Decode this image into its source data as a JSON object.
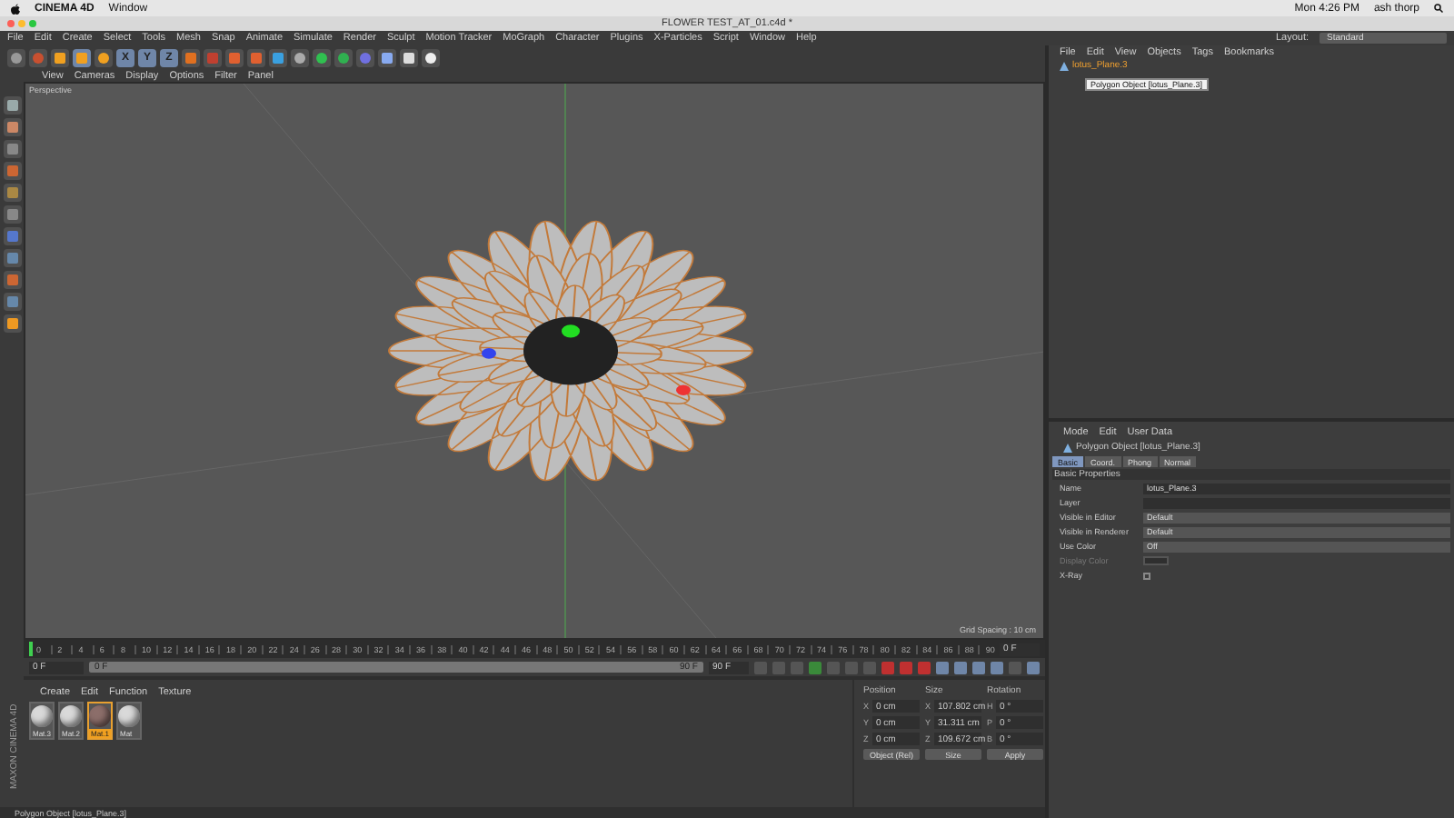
{
  "mac_menu_bar": {
    "app": "CINEMA 4D",
    "menus": [
      "Window"
    ],
    "clock": "Mon 4:26 PM",
    "user": "ash thorp"
  },
  "window": {
    "title": "FLOWER TEST_AT_01.c4d *"
  },
  "menu_bar": {
    "items": [
      "File",
      "Edit",
      "Create",
      "Select",
      "Tools",
      "Mesh",
      "Snap",
      "Animate",
      "Simulate",
      "Render",
      "Sculpt",
      "Motion Tracker",
      "MoGraph",
      "Character",
      "Plugins",
      "X-Particles",
      "Script",
      "Window",
      "Help"
    ],
    "layout_label": "Layout:",
    "layout_value": "Standard"
  },
  "toolbar": {
    "axis_locks": [
      {
        "label": "X",
        "selected": true
      },
      {
        "label": "Y",
        "selected": true
      },
      {
        "label": "Z",
        "selected": true
      }
    ]
  },
  "viewport": {
    "menus": [
      "View",
      "Cameras",
      "Display",
      "Options",
      "Filter",
      "Panel"
    ],
    "camera_label": "Perspective",
    "grid_spacing": "Grid Spacing : 10 cm"
  },
  "timeline": {
    "ticks": [
      "0",
      "2",
      "4",
      "6",
      "8",
      "10",
      "12",
      "14",
      "16",
      "18",
      "20",
      "22",
      "24",
      "26",
      "28",
      "30",
      "32",
      "34",
      "36",
      "38",
      "40",
      "42",
      "44",
      "46",
      "48",
      "50",
      "52",
      "54",
      "56",
      "58",
      "60",
      "62",
      "64",
      "66",
      "68",
      "70",
      "72",
      "74",
      "76",
      "78",
      "80",
      "82",
      "84",
      "86",
      "88",
      "90"
    ],
    "playhead": {
      "level": 0
    },
    "end_label": "0 F"
  },
  "range": {
    "level": 1,
    "current": "0 F",
    "range_start": "0 F",
    "range_end": "90 F",
    "max": "90 F"
  },
  "materials": {
    "menus": [
      "Create",
      "Edit",
      "Function",
      "Texture"
    ],
    "items": [
      {
        "name": "Mat.3",
        "selected": false,
        "color": "#d9d9d9"
      },
      {
        "name": "Mat.2",
        "selected": false,
        "color": "#d9d9d9"
      },
      {
        "name": "Mat.1",
        "selected": true,
        "color": "#8c6e6a"
      },
      {
        "name": "Mat",
        "selected": false,
        "color": "#d9d9d9"
      }
    ]
  },
  "coordinates": {
    "headers": [
      "Position",
      "Size",
      "Rotation"
    ],
    "rows": [
      {
        "cells": [
          {
            "axis": "X",
            "value": "0 cm"
          },
          {
            "axis": "X",
            "value": "107.802 cm"
          },
          {
            "axis": "H",
            "value": "0 °"
          }
        ]
      },
      {
        "cells": [
          {
            "axis": "Y",
            "value": "0 cm"
          },
          {
            "axis": "Y",
            "value": "31.311 cm"
          },
          {
            "axis": "P",
            "value": "0 °"
          }
        ]
      },
      {
        "cells": [
          {
            "axis": "Z",
            "value": "0 cm"
          },
          {
            "axis": "Z",
            "value": "109.672 cm"
          },
          {
            "axis": "B",
            "value": "0 °"
          }
        ]
      }
    ],
    "mode": "Object (Rel)",
    "size_mode": "Size",
    "apply": "Apply"
  },
  "objects_manager": {
    "menus": [
      "File",
      "Edit",
      "View",
      "Objects",
      "Tags",
      "Bookmarks"
    ],
    "objects": [
      {
        "name": "lotus_Plane.3",
        "selected": true
      }
    ],
    "tooltip": "Polygon Object [lotus_Plane.3]"
  },
  "attributes": {
    "menus": [
      "Mode",
      "Edit",
      "User Data"
    ],
    "title": "Polygon Object [lotus_Plane.3]",
    "tabs": [
      {
        "label": "Basic",
        "selected": true
      },
      {
        "label": "Coord.",
        "selected": false
      },
      {
        "label": "Phong",
        "selected": false
      },
      {
        "label": "Normal",
        "selected": false
      }
    ],
    "section": "Basic Properties",
    "properties": [
      {
        "label": "Name",
        "kind": "text",
        "value": "lotus_Plane.3",
        "disabled": false
      },
      {
        "label": "Layer",
        "kind": "link",
        "disabled": false
      },
      {
        "label": "Visible in Editor",
        "kind": "dropdown",
        "value": "Default",
        "disabled": false
      },
      {
        "label": "Visible in Renderer",
        "kind": "dropdown",
        "value": "Default",
        "disabled": false
      },
      {
        "label": "Use Color",
        "kind": "dropdown",
        "value": "Off",
        "disabled": false
      },
      {
        "label": "Display Color",
        "kind": "color",
        "disabled": true
      },
      {
        "label": "X-Ray",
        "kind": "checkbox",
        "checked": false,
        "disabled": false
      }
    ]
  },
  "brand": "MAXON CINEMA 4D",
  "status_bar": {
    "text": "Polygon Object [lotus_Plane.3]"
  }
}
